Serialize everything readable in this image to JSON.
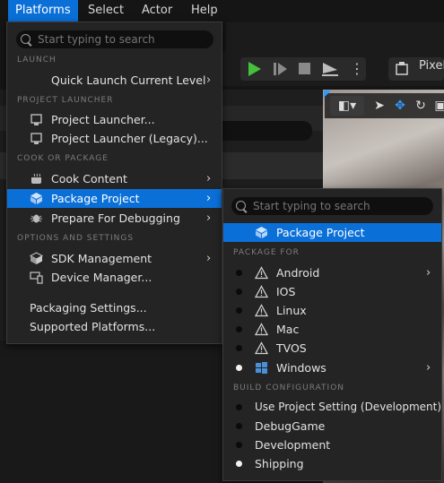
{
  "menubar": {
    "items": [
      {
        "label": "Platforms",
        "active": true
      },
      {
        "label": "Select"
      },
      {
        "label": "Actor"
      },
      {
        "label": "Help"
      }
    ]
  },
  "toolbar": {
    "play_icon": "play-icon",
    "step_icon": "step-icon",
    "stop_icon": "stop-icon",
    "eject_icon": "eject-icon",
    "more_icon": "vertical-dots-icon",
    "pixel_label": "Pixel"
  },
  "platforms_menu": {
    "search_placeholder": "Start typing to search",
    "sections": {
      "launch": "LAUNCH",
      "project_launcher": "PROJECT LAUNCHER",
      "cook_or_package": "COOK OR PACKAGE",
      "options_and_settings": "OPTIONS AND SETTINGS"
    },
    "items": {
      "quick_launch": "Quick Launch Current Level",
      "project_launcher": "Project Launcher...",
      "project_launcher_legacy": "Project Launcher (Legacy)...",
      "cook_content": "Cook Content",
      "package_project": "Package Project",
      "prepare_debugging": "Prepare For Debugging",
      "sdk_management": "SDK Management",
      "device_manager": "Device Manager...",
      "packaging_settings": "Packaging Settings...",
      "supported_platforms": "Supported Platforms..."
    }
  },
  "package_submenu": {
    "search_placeholder": "Start typing to search",
    "package_project": "Package Project",
    "section_package_for": "PACKAGE FOR",
    "platforms": [
      {
        "label": "Android",
        "selected": false,
        "submenu": true
      },
      {
        "label": "IOS",
        "selected": false
      },
      {
        "label": "Linux",
        "selected": false
      },
      {
        "label": "Mac",
        "selected": false
      },
      {
        "label": "TVOS",
        "selected": false
      },
      {
        "label": "Windows",
        "selected": true,
        "submenu": true
      }
    ],
    "section_build_configuration": "BUILD CONFIGURATION",
    "configurations": [
      {
        "label": "Use Project Setting (Development)",
        "selected": false
      },
      {
        "label": "DebugGame",
        "selected": false
      },
      {
        "label": "Development",
        "selected": false
      },
      {
        "label": "Shipping",
        "selected": true
      }
    ]
  },
  "colors": {
    "accent": "#0a70d8",
    "menu_bg": "#242424",
    "play_green": "#44c23a"
  }
}
